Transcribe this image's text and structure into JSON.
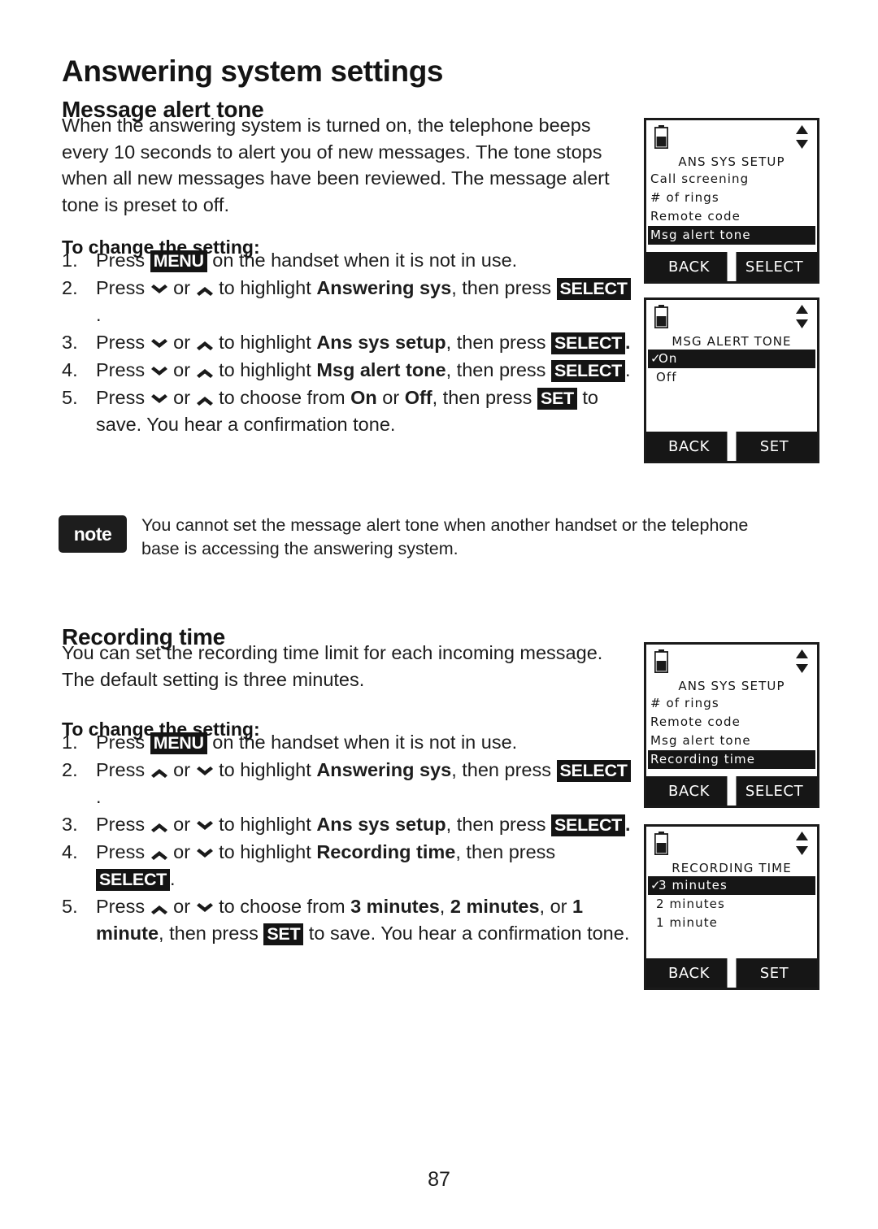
{
  "page": {
    "title": "Answering system settings",
    "number": "87"
  },
  "sections": [
    {
      "heading": "Message alert tone",
      "paragraph": "When the answering system is turned on, the telephone beeps every 10 seconds to alert you of new messages. The tone stops when all new messages have been reviewed. The message alert tone is preset to off.",
      "subheading": "To change the setting:",
      "steps": [
        {
          "num": "1.",
          "parts": [
            {
              "t": "text",
              "v": "Press "
            },
            {
              "t": "key",
              "v": "MENU"
            },
            {
              "t": "text",
              "v": " on the handset when it is not in use."
            }
          ]
        },
        {
          "num": "2.",
          "parts": [
            {
              "t": "text",
              "v": "Press "
            },
            {
              "t": "icon",
              "v": "chevron-down-icon"
            },
            {
              "t": "text",
              "v": " or "
            },
            {
              "t": "icon",
              "v": "chevron-up-icon"
            },
            {
              "t": "text",
              "v": " to highlight "
            },
            {
              "t": "bold",
              "v": "Answering sys"
            },
            {
              "t": "text",
              "v": ", then press "
            },
            {
              "t": "key",
              "v": "SELECT"
            },
            {
              "t": "text",
              "v": "."
            }
          ]
        },
        {
          "num": "3.",
          "parts": [
            {
              "t": "text",
              "v": "Press "
            },
            {
              "t": "icon",
              "v": "chevron-down-icon"
            },
            {
              "t": "text",
              "v": " or "
            },
            {
              "t": "icon",
              "v": "chevron-up-icon"
            },
            {
              "t": "text",
              "v": " to highlight "
            },
            {
              "t": "bold",
              "v": "Ans sys setup"
            },
            {
              "t": "text",
              "v": ", then press "
            },
            {
              "t": "key",
              "v": "SELECT"
            },
            {
              "t": "bold",
              "v": "."
            }
          ]
        },
        {
          "num": "4.",
          "parts": [
            {
              "t": "text",
              "v": "Press "
            },
            {
              "t": "icon",
              "v": "chevron-down-icon"
            },
            {
              "t": "text",
              "v": " or "
            },
            {
              "t": "icon",
              "v": "chevron-up-icon"
            },
            {
              "t": "text",
              "v": " to highlight "
            },
            {
              "t": "bold",
              "v": "Msg alert tone"
            },
            {
              "t": "text",
              "v": ", then press "
            },
            {
              "t": "key",
              "v": "SELECT"
            },
            {
              "t": "text",
              "v": "."
            }
          ]
        },
        {
          "num": "5.",
          "parts": [
            {
              "t": "text",
              "v": "Press "
            },
            {
              "t": "icon",
              "v": "chevron-down-icon"
            },
            {
              "t": "text",
              "v": " or "
            },
            {
              "t": "icon",
              "v": "chevron-up-icon"
            },
            {
              "t": "text",
              "v": " to choose from "
            },
            {
              "t": "bold",
              "v": "On"
            },
            {
              "t": "text",
              "v": " or "
            },
            {
              "t": "bold",
              "v": "Off"
            },
            {
              "t": "text",
              "v": ", then press "
            },
            {
              "t": "key",
              "v": "SET"
            },
            {
              "t": "text",
              "v": " to save. You hear a confirmation tone."
            }
          ]
        }
      ]
    },
    {
      "heading": "Recording time",
      "paragraph": "You can set the recording time limit for each incoming message. The default setting is three minutes.",
      "subheading": "To change the setting:",
      "steps": [
        {
          "num": "1.",
          "parts": [
            {
              "t": "text",
              "v": "Press "
            },
            {
              "t": "key",
              "v": "MENU"
            },
            {
              "t": "text",
              "v": " on the handset when it is not in use."
            }
          ]
        },
        {
          "num": "2.",
          "parts": [
            {
              "t": "text",
              "v": "Press "
            },
            {
              "t": "icon",
              "v": "chevron-up-icon"
            },
            {
              "t": "text",
              "v": " or "
            },
            {
              "t": "icon",
              "v": "chevron-down-icon"
            },
            {
              "t": "text",
              "v": " to highlight "
            },
            {
              "t": "bold",
              "v": "Answering sys"
            },
            {
              "t": "text",
              "v": ", then press "
            },
            {
              "t": "key",
              "v": "SELECT"
            },
            {
              "t": "text",
              "v": "."
            }
          ]
        },
        {
          "num": "3.",
          "parts": [
            {
              "t": "text",
              "v": "Press "
            },
            {
              "t": "icon",
              "v": "chevron-up-icon"
            },
            {
              "t": "text",
              "v": " or "
            },
            {
              "t": "icon",
              "v": "chevron-down-icon"
            },
            {
              "t": "text",
              "v": " to highlight "
            },
            {
              "t": "bold",
              "v": "Ans sys setup"
            },
            {
              "t": "text",
              "v": ", then press "
            },
            {
              "t": "key",
              "v": "SELECT"
            },
            {
              "t": "bold",
              "v": "."
            }
          ]
        },
        {
          "num": "4.",
          "parts": [
            {
              "t": "text",
              "v": "Press "
            },
            {
              "t": "icon",
              "v": "chevron-up-icon"
            },
            {
              "t": "text",
              "v": " or "
            },
            {
              "t": "icon",
              "v": "chevron-down-icon"
            },
            {
              "t": "text",
              "v": " to highlight "
            },
            {
              "t": "bold",
              "v": "Recording time"
            },
            {
              "t": "text",
              "v": ", then press "
            },
            {
              "t": "key",
              "v": "SELECT"
            },
            {
              "t": "text",
              "v": "."
            }
          ]
        },
        {
          "num": "5.",
          "parts": [
            {
              "t": "text",
              "v": "Press "
            },
            {
              "t": "icon",
              "v": "chevron-up-icon"
            },
            {
              "t": "text",
              "v": " or "
            },
            {
              "t": "icon",
              "v": "chevron-down-icon"
            },
            {
              "t": "text",
              "v": " to choose from "
            },
            {
              "t": "bold",
              "v": "3 minutes"
            },
            {
              "t": "text",
              "v": ", "
            },
            {
              "t": "bold",
              "v": "2 minutes"
            },
            {
              "t": "text",
              "v": ", or "
            },
            {
              "t": "bold",
              "v": "1 minute"
            },
            {
              "t": "text",
              "v": ", then press "
            },
            {
              "t": "key",
              "v": "SET"
            },
            {
              "t": "text",
              "v": " to save. You hear a confirmation tone."
            }
          ]
        }
      ]
    }
  ],
  "note": {
    "badge": "note",
    "text": "You cannot set the message alert tone when another handset or the telephone base is accessing the answering system."
  },
  "screens": [
    {
      "id": "ans-sys-setup-msg-alert",
      "title": "ANS SYS SETUP",
      "rows": [
        {
          "label": "Call screening",
          "selected": false,
          "check": false
        },
        {
          "label": "# of rings",
          "selected": false,
          "check": false
        },
        {
          "label": "Remote code",
          "selected": false,
          "check": false
        },
        {
          "label": "Msg alert tone",
          "selected": true,
          "check": false
        }
      ],
      "softkeys": {
        "left": "BACK",
        "right": "SELECT"
      },
      "battery": "battery-half-icon",
      "scroll": "scroll-updown-icon"
    },
    {
      "id": "msg-alert-tone-options",
      "title": "MSG ALERT TONE",
      "rows": [
        {
          "label": "On",
          "selected": true,
          "check": true
        },
        {
          "label": "Off",
          "selected": false,
          "check": false
        }
      ],
      "softkeys": {
        "left": "BACK",
        "right": "SET"
      },
      "battery": "battery-half-icon",
      "scroll": "scroll-updown-icon"
    },
    {
      "id": "ans-sys-setup-recording",
      "title": "ANS SYS SETUP",
      "rows": [
        {
          "label": "# of rings",
          "selected": false,
          "check": false
        },
        {
          "label": "Remote code",
          "selected": false,
          "check": false
        },
        {
          "label": "Msg alert tone",
          "selected": false,
          "check": false
        },
        {
          "label": "Recording time",
          "selected": true,
          "check": false
        }
      ],
      "softkeys": {
        "left": "BACK",
        "right": "SELECT"
      },
      "battery": "battery-half-icon",
      "scroll": "scroll-updown-icon"
    },
    {
      "id": "recording-time-options",
      "title": "RECORDING TIME",
      "rows": [
        {
          "label": "3 minutes",
          "selected": true,
          "check": true
        },
        {
          "label": "2 minutes",
          "selected": false,
          "check": false
        },
        {
          "label": "1 minute",
          "selected": false,
          "check": false
        }
      ],
      "softkeys": {
        "left": "BACK",
        "right": "SET"
      },
      "battery": "battery-half-icon",
      "scroll": "scroll-updown-icon"
    }
  ],
  "colors": {
    "ink": "#1a1a1a",
    "paper": "#ffffff",
    "highlight": "#161616"
  }
}
